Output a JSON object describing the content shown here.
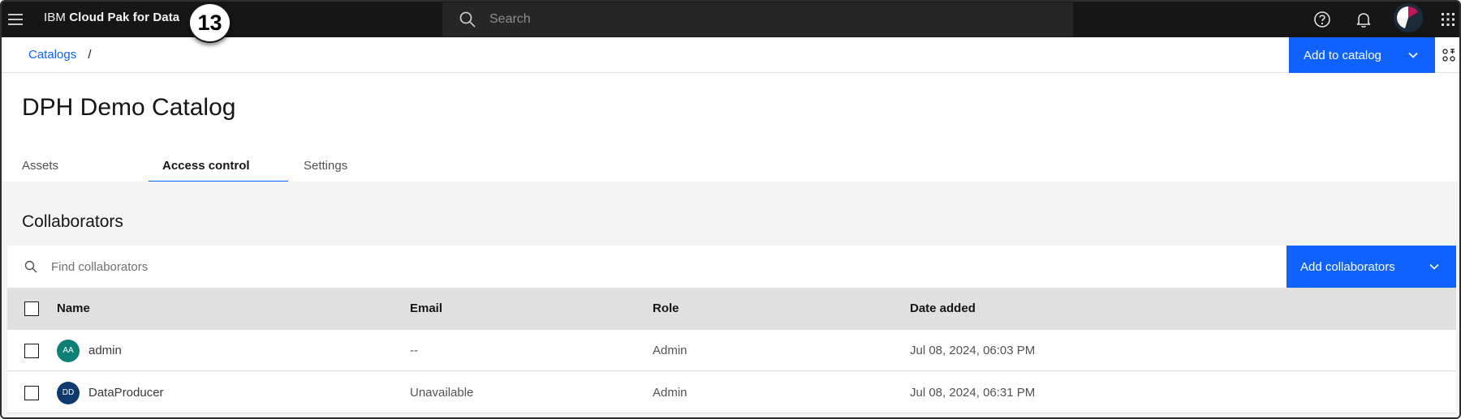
{
  "header": {
    "brand_prefix": "IBM",
    "brand_name": "Cloud Pak for Data",
    "step_badge": "13",
    "search_placeholder": "Search",
    "icons": [
      "menu-icon",
      "search-icon",
      "help-icon",
      "notification-icon",
      "user-avatar",
      "app-switcher-icon"
    ]
  },
  "breadcrumb": {
    "items": [
      "Catalogs"
    ],
    "separator": "/"
  },
  "toolbar": {
    "add_to_catalog_label": "Add to catalog"
  },
  "page": {
    "title": "DPH Demo Catalog",
    "tabs": [
      {
        "label": "Assets",
        "active": false
      },
      {
        "label": "Access control",
        "active": true
      },
      {
        "label": "Settings",
        "active": false
      }
    ]
  },
  "collaborators": {
    "section_title": "Collaborators",
    "search_placeholder": "Find collaborators",
    "add_button_label": "Add collaborators",
    "columns": [
      "Name",
      "Email",
      "Role",
      "Date added"
    ],
    "rows": [
      {
        "initials": "AA",
        "name": "admin",
        "email": "--",
        "role": "Admin",
        "date_added": "Jul 08, 2024, 06:03 PM",
        "avatar_color": "#0e7f74"
      },
      {
        "initials": "DD",
        "name": "DataProducer",
        "email": "Unavailable",
        "role": "Admin",
        "date_added": "Jul 08, 2024, 06:31 PM",
        "avatar_color": "#10396e"
      }
    ]
  },
  "colors": {
    "accent": "#0f62fe",
    "header_bg": "#161616",
    "table_header_bg": "#e0e0e0",
    "section_bg": "#f4f4f4"
  }
}
